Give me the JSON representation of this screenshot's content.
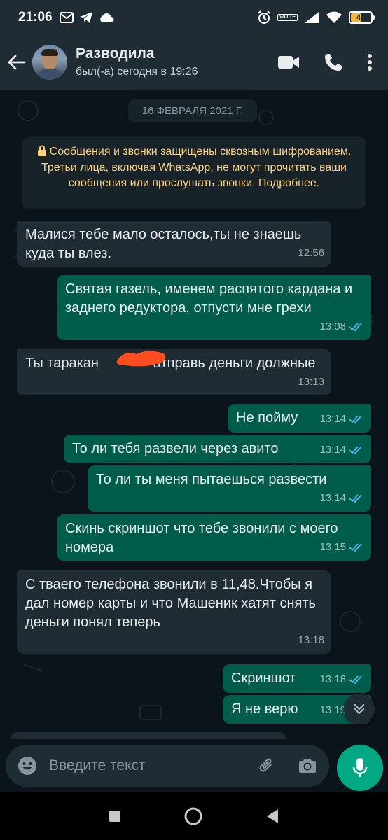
{
  "status_bar": {
    "time": "21:06",
    "battery_level": "49",
    "net_label": "Vo LTE"
  },
  "header": {
    "contact_name": "Разводила",
    "last_seen": "был(-а) сегодня в 19:26"
  },
  "chat": {
    "date_label": "16 ФЕВРАЛЯ 2021 Г.",
    "encryption_notice": "Сообщения и звонки защищены сквозным шифрованием. Третьи лица, включая WhatsApp, не могут прочитать ваши сообщения или прослушать звонки. Подробнее.",
    "messages": [
      {
        "direction": "in",
        "text": "Малися тебе мало осталось,ты не знаешь куда ты влез.",
        "time": "12:56"
      },
      {
        "direction": "out",
        "text": "Святая газель, именем распятого кардана и заднего редуктора, отпусти мне грехи",
        "time": "13:08",
        "read": true
      },
      {
        "direction": "in",
        "text": "Ты таракан ______ атправь деньги должные",
        "time": "13:13"
      },
      {
        "direction": "out",
        "text": "Не пойму",
        "time": "13:14",
        "read": true
      },
      {
        "direction": "out",
        "text": "То ли тебя развели через авито",
        "time": "13:14",
        "read": true
      },
      {
        "direction": "out",
        "text": "То ли ты меня пытаешься развести",
        "time": "13:14",
        "read": true
      },
      {
        "direction": "out",
        "text": "Скинь скриншот что тебе звонили с моего номера",
        "time": "13:15",
        "read": true
      },
      {
        "direction": "in",
        "text": "С тваего телефона звонили в 11,48.Чтобы я дал номер карты и что Машеник хатят снять деньги понял теперь",
        "time": "13:18"
      },
      {
        "direction": "out",
        "text": "Скриншот",
        "time": "13:18",
        "read": true
      },
      {
        "direction": "out",
        "text": "Я не верю",
        "time": "13:19",
        "read": true
      }
    ]
  },
  "composer": {
    "placeholder": "Введите текст"
  },
  "colors": {
    "incoming_bubble": "#202c33",
    "outgoing_bubble": "#005c4b",
    "accent": "#00a884",
    "read_ticks": "#53bdeb",
    "notice_text": "#ffd279"
  }
}
